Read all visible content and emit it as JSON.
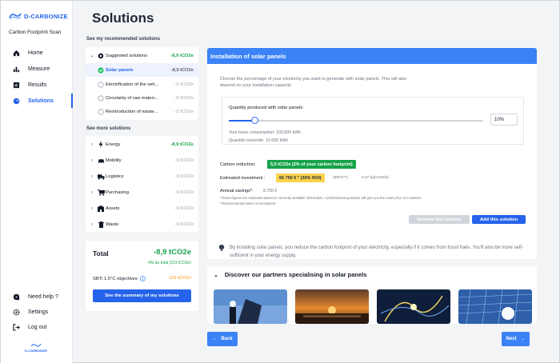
{
  "brand": {
    "name": "D-CARBONIZE",
    "subtitle": "Carbon Footprint Scan",
    "accent": "#2563eb"
  },
  "nav": {
    "items": [
      {
        "label": "Home",
        "icon": "home-icon",
        "active": false
      },
      {
        "label": "Measure",
        "icon": "bar-chart-icon",
        "active": false
      },
      {
        "label": "Results",
        "icon": "results-icon",
        "active": false
      },
      {
        "label": "Solutions",
        "icon": "gauge-icon",
        "active": true
      }
    ],
    "bottom": [
      {
        "label": "Need help ?",
        "icon": "help-icon"
      },
      {
        "label": "Settings",
        "icon": "gear-icon"
      },
      {
        "label": "Log out",
        "icon": "logout-icon"
      }
    ]
  },
  "page": {
    "title": "Solutions"
  },
  "recommended": {
    "section_label": "See my recommended solutions",
    "group": {
      "label": "Suggested solutions",
      "value": "-8,9 tCO2e"
    },
    "items": [
      {
        "label": "Solar panels",
        "value": "-8,9 tCO2e",
        "selected": true
      },
      {
        "label": "Electrification of the veh...",
        "value": "- 0 tCO2e",
        "selected": false
      },
      {
        "label": "Circularity of raw materi...",
        "value": "- 0 tCO2e",
        "selected": false
      },
      {
        "label": "Reintroduction of waste...",
        "value": "- 0 tCO2e",
        "selected": false
      }
    ]
  },
  "more": {
    "section_label": "See more solutions",
    "items": [
      {
        "label": "Energy",
        "value": "-8,9 tCO2e",
        "icon": "lightning-icon",
        "highlight": true
      },
      {
        "label": "Mobility",
        "value": "- 0 tCO2e",
        "icon": "car-icon",
        "highlight": false
      },
      {
        "label": "Logistics",
        "value": "- 0 tCO2e",
        "icon": "truck-icon",
        "highlight": false
      },
      {
        "label": "Purchasing",
        "value": "- 0 tCO2e",
        "icon": "cart-icon",
        "highlight": false
      },
      {
        "label": "Assets",
        "value": "- 0 tCO2e",
        "icon": "building-icon",
        "highlight": false
      },
      {
        "label": "Waste",
        "value": "- 0 tCO2e",
        "icon": "trash-icon",
        "highlight": false
      }
    ]
  },
  "total": {
    "label": "Total",
    "value": "-8,9 tCO2e",
    "sub": "4% du total (223 tCO2e)",
    "sbti_label": "SBTi 1,5°C objectives",
    "sbti_value": "-115 tCO2e",
    "summary_button": "See the summary of my solutions"
  },
  "panel": {
    "title": "Installation of solar panels",
    "description": "Choose the percentage of your electricity you want to generate with solar panels. This will also depend on your installation capacity.",
    "qty_label": "Quantity produced with solar panels:",
    "slider_fraction": 0.1,
    "percent_value": "10%",
    "basic_consumption": "Your basic consumption: 100,000 kWh",
    "converted_quantity": "Quantité convertie: 10 000 kWh",
    "carbon_reduction_label": "Carbon reduction:",
    "carbon_reduction_badge": "5,5 tCO2e (2% of your carbon footprint)",
    "investment_label": "Estimated investment :",
    "investment_badge": "66 750 € * (30% ROI)",
    "erpi_label": "(EROI**) :",
    "erpi_value": "0,27 kgCO2e/€)",
    "savings_label": "Annual savings*:",
    "savings_value": "8.750 €",
    "note1": "*These figures are estimates based on currently available information. A professional quotation will give you the exact price of a solution.",
    "note2": "**Environmental return on investment",
    "remove_button": "Remove this solution",
    "add_button": "Add this solution"
  },
  "info": "By installing solar panels, you reduce the carbon footprint of your electricity, especially if it comes from fossil fuels. You'll also be more self-sufficient in your energy supply.",
  "partners": {
    "title": "Discover our partners specialising in solar panels"
  },
  "footer": {
    "back": "Back",
    "next": "Next"
  }
}
